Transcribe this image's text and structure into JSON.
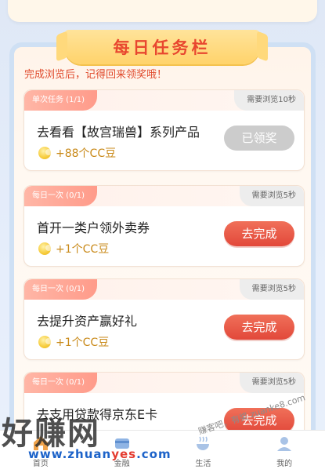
{
  "banner": {
    "title": "每日任务栏"
  },
  "subtitle": "完成浏览后，记得回来领奖哦！",
  "tasks": [
    {
      "tag": "单次任务 (1/1)",
      "requirement": "需要浏览10秒",
      "title": "去看看【故宫瑞兽】系列产品",
      "reward": "+88个CC豆",
      "button": "已领奖",
      "button_state": "disabled"
    },
    {
      "tag": "每日一次 (0/1)",
      "requirement": "需要浏览5秒",
      "title": "首开一类户领外卖券",
      "reward": "+1个CC豆",
      "button": "去完成",
      "button_state": "active"
    },
    {
      "tag": "每日一次 (0/1)",
      "requirement": "需要浏览5秒",
      "title": "去提升资产赢好礼",
      "reward": "+1个CC豆",
      "button": "去完成",
      "button_state": "active"
    },
    {
      "tag": "每日一次 (0/1)",
      "requirement": "需要浏览5秒",
      "title": "去支用贷款得京东E卡",
      "reward": "",
      "button": "去完成",
      "button_state": "active"
    }
  ],
  "tabbar": [
    {
      "label": "首页",
      "icon": "home-icon"
    },
    {
      "label": "金融",
      "icon": "finance-icon"
    },
    {
      "label": "生活",
      "icon": "life-icon"
    },
    {
      "label": "我的",
      "icon": "profile-icon"
    }
  ],
  "watermark": {
    "brand": "好赚网",
    "url_main": "www.zhuan",
    "url_accent": "yes",
    "url_tail": ".com",
    "right_text": "赚客吧，有奖 zuanke8.com"
  },
  "colors": {
    "accent": "#e2483a",
    "title": "#e8472f",
    "coin": "#f6cb3a"
  }
}
